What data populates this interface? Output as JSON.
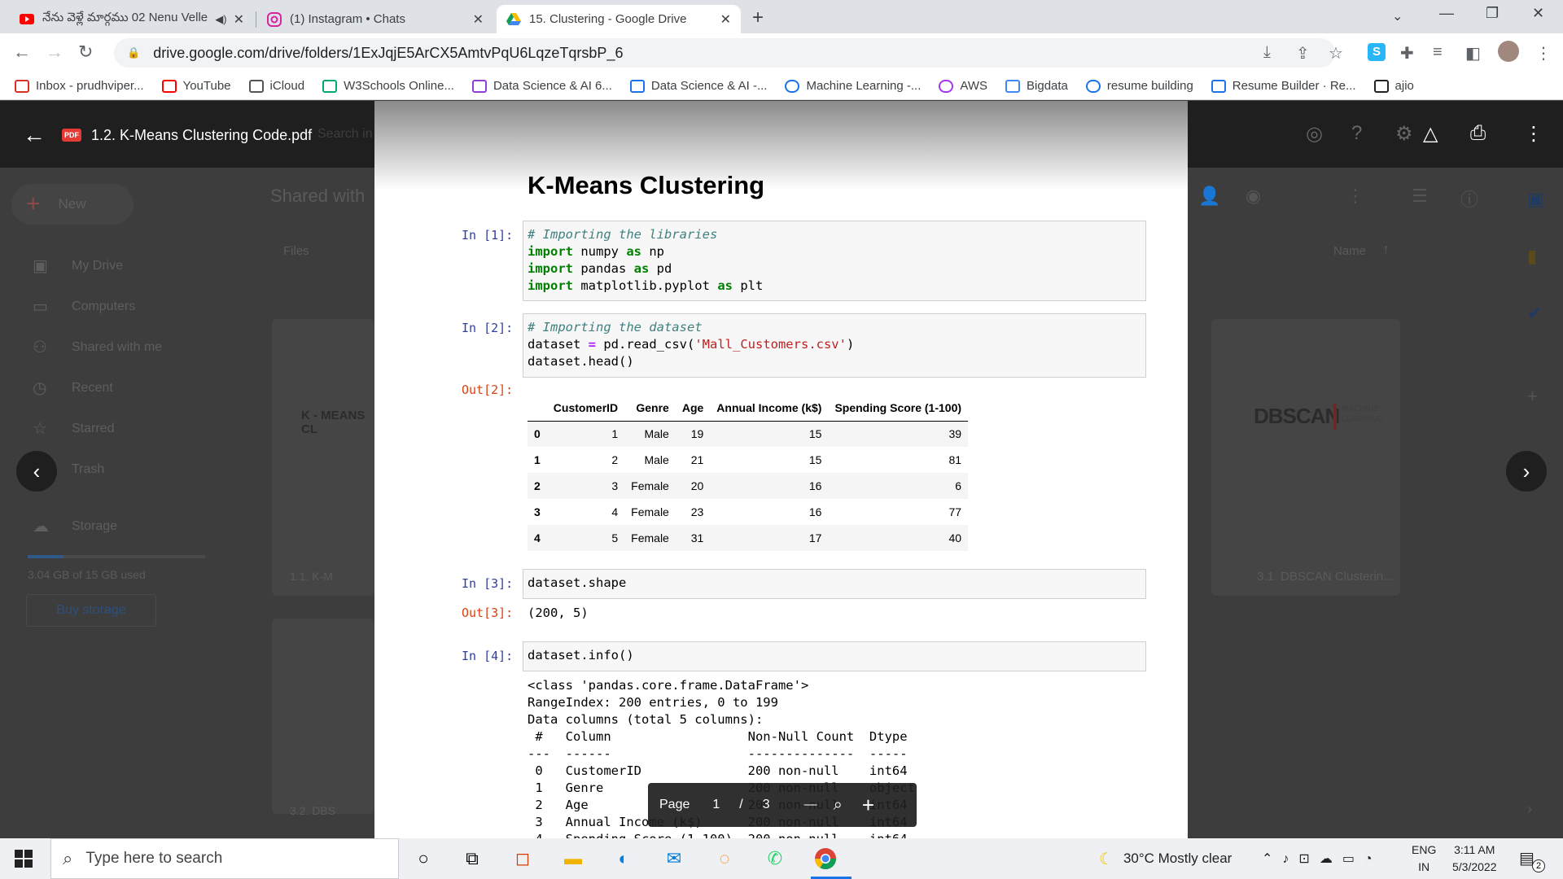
{
  "tabs": [
    {
      "title": "నేను వెళ్లే మార్గము 02 Nenu Velle"
    },
    {
      "title": "(1) Instagram • Chats"
    },
    {
      "title": "15. Clustering - Google Drive"
    }
  ],
  "address": {
    "url": "drive.google.com/drive/folders/1ExJqjE5ArCX5AmtvPqU6LqzeTqrsbP_6"
  },
  "bookmarks": [
    {
      "label": "Inbox - prudhviper...",
      "icon": "gmail-icon",
      "color": "#d93025"
    },
    {
      "label": "YouTube",
      "icon": "youtube-icon",
      "color": "#ff0000"
    },
    {
      "label": "iCloud",
      "icon": "apple-icon",
      "color": "#555555"
    },
    {
      "label": "W3Schools Online...",
      "icon": "w3schools-icon",
      "color": "#04aa6d"
    },
    {
      "label": "Data Science & AI 6...",
      "icon": "folder-icon",
      "color": "#8e3fd6"
    },
    {
      "label": "Data Science & AI -...",
      "icon": "drive-icon",
      "color": "#1a73e8"
    },
    {
      "label": "Machine Learning -...",
      "icon": "c-icon",
      "color": "#1a73e8"
    },
    {
      "label": "AWS",
      "icon": "u-icon",
      "color": "#a435f0"
    },
    {
      "label": "Bigdata",
      "icon": "google-icon",
      "color": "#4285f4"
    },
    {
      "label": "resume building",
      "icon": "c-icon",
      "color": "#1a73e8"
    },
    {
      "label": "Resume Builder · Re...",
      "icon": "doc-icon",
      "color": "#1a73e8"
    },
    {
      "label": "ajio",
      "icon": "ajio-icon",
      "color": "#222222"
    }
  ],
  "viewer": {
    "file_name": "1.2. K-Means Clustering Code.pdf",
    "pdf_badge": "PDF"
  },
  "drive": {
    "search_placeholder": "Search in Drive",
    "new_label": "New",
    "shared_heading": "Shared with",
    "files_label": "Files",
    "name_label": "Name",
    "sidebar": [
      {
        "label": "My Drive",
        "icon": "my-drive-icon"
      },
      {
        "label": "Computers",
        "icon": "computer-icon"
      },
      {
        "label": "Shared with me",
        "icon": "people-icon"
      },
      {
        "label": "Recent",
        "icon": "clock-icon"
      },
      {
        "label": "Starred",
        "icon": "star-icon"
      },
      {
        "label": "Trash",
        "icon": "trash-icon"
      },
      {
        "label": "Storage",
        "icon": "cloud-icon"
      }
    ],
    "storage_used": "3.04 GB of 15 GB used",
    "storage_fraction": 0.2,
    "buy_storage": "Buy storage",
    "cards": [
      {
        "thumb": "K - MEANS CL",
        "name": "1.1. K-M"
      },
      {
        "thumb": "",
        "name": "3.2. DBS"
      },
      {
        "thumb": "DBSCAN",
        "thumb_sub": "MACHINE LEARNING",
        "name": "3.1. DBSCAN Clusterin..."
      }
    ]
  },
  "notebook": {
    "title": "K-Means Clustering",
    "cells": [
      {
        "prompt": "In [1]:",
        "lines": [
          {
            "comment": "# Importing the libraries"
          },
          {
            "kw": "import",
            "rest": " numpy ",
            "kw2": "as",
            "rest2": " np"
          },
          {
            "kw": "import",
            "rest": " pandas ",
            "kw2": "as",
            "rest2": " pd"
          },
          {
            "kw": "import",
            "rest": " matplotlib.pyplot ",
            "kw2": "as",
            "rest2": " plt"
          }
        ]
      },
      {
        "prompt": "In [2]:",
        "comment": "# Importing the dataset",
        "line2_a": "dataset ",
        "line2_op": "=",
        "line2_b": " pd.read_csv(",
        "line2_str": "'Mall_Customers.csv'",
        "line2_c": ")",
        "line3": "dataset.head()"
      },
      {
        "prompt": "In [3]:",
        "code": "dataset.shape"
      },
      {
        "prompt": "In [4]:",
        "code": "dataset.info()"
      }
    ],
    "out2_prompt": "Out[2]:",
    "out3_prompt": "Out[3]:",
    "out3_value": "(200, 5)",
    "table": {
      "columns": [
        "",
        "CustomerID",
        "Genre",
        "Age",
        "Annual Income (k$)",
        "Spending Score (1-100)"
      ],
      "rows": [
        [
          "0",
          "1",
          "Male",
          "19",
          "15",
          "39"
        ],
        [
          "1",
          "2",
          "Male",
          "21",
          "15",
          "81"
        ],
        [
          "2",
          "3",
          "Female",
          "20",
          "16",
          "6"
        ],
        [
          "3",
          "4",
          "Female",
          "23",
          "16",
          "77"
        ],
        [
          "4",
          "5",
          "Female",
          "31",
          "17",
          "40"
        ]
      ]
    },
    "info_lines": [
      "<class 'pandas.core.frame.DataFrame'>",
      "RangeIndex: 200 entries, 0 to 199",
      "Data columns (total 5 columns):",
      " #   Column                  Non-Null Count  Dtype ",
      "---  ------                  --------------  ----- ",
      " 0   CustomerID              200 non-null    int64 ",
      " 1   Genre                   200 non-null    object",
      " 2   Age                     200 non-null    int64 ",
      " 3   Annual Income (k$)      200 non-null    int64 ",
      " 4   Spending Score (1-100)  200 non-null    int64 "
    ]
  },
  "page_control": {
    "label": "Page",
    "current": "1",
    "separator": "/",
    "total": "3",
    "minus": "—"
  },
  "taskbar": {
    "search_placeholder": "Type here to search",
    "weather": "30°C  Mostly clear",
    "lang_top": "ENG",
    "lang_bottom": "IN",
    "time": "3:11 AM",
    "date": "5/3/2022",
    "notification_count": "2"
  }
}
